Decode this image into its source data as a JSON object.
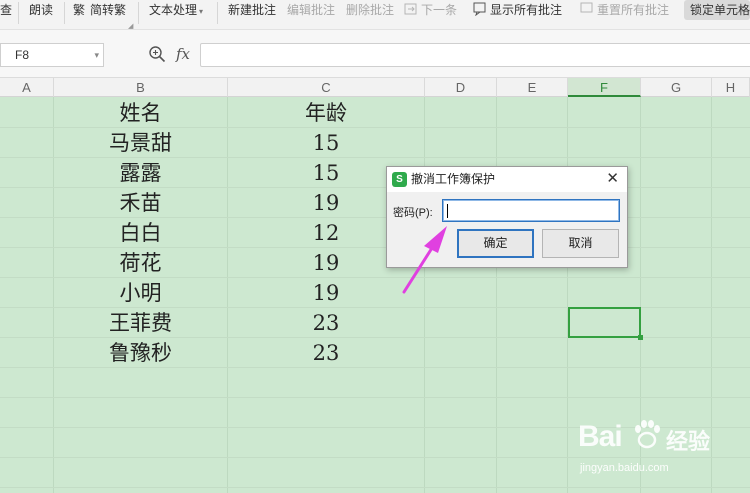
{
  "toolbar": {
    "partial_left": "查",
    "read_aloud": "朗读",
    "trad_simp": "简转繁",
    "text_processing": "文本处理",
    "new_comment": "新建批注",
    "edit_comment": "编辑批注",
    "delete_comment": "删除批注",
    "next": "下一条",
    "show_all_comments": "显示所有批注",
    "reset_all_comments": "重置所有批注",
    "lock_cell": "锁定单元格"
  },
  "formula_bar": {
    "name_box": "F8",
    "fx": "fx",
    "formula": ""
  },
  "columns": [
    "A",
    "B",
    "C",
    "D",
    "E",
    "F",
    "G",
    "H"
  ],
  "active_column": "F",
  "sheet": {
    "header_name": "姓名",
    "header_age": "年龄",
    "rows": [
      {
        "name": "马景甜",
        "age": "15"
      },
      {
        "name": "露露",
        "age": "15"
      },
      {
        "name": "禾苗",
        "age": "19"
      },
      {
        "name": "白白",
        "age": "12"
      },
      {
        "name": "荷花",
        "age": "19"
      },
      {
        "name": "小明",
        "age": "19"
      },
      {
        "name": "王菲费",
        "age": "23"
      },
      {
        "name": "鲁豫秒",
        "age": "23"
      }
    ]
  },
  "dialog": {
    "logo": "S",
    "title": "撤消工作簿保护",
    "close": "✕",
    "password_label": "密码(P):",
    "password_value": "",
    "ok": "确定",
    "cancel": "取消"
  },
  "watermark": {
    "brand": "Bai",
    "brand_cn": "经验",
    "url": "jingyan.baidu.com"
  },
  "colors": {
    "sheet_bg": "#cde8d0",
    "accent_green": "#34a040",
    "annotation": "#e040e0",
    "focus_blue": "#2f74c0"
  }
}
